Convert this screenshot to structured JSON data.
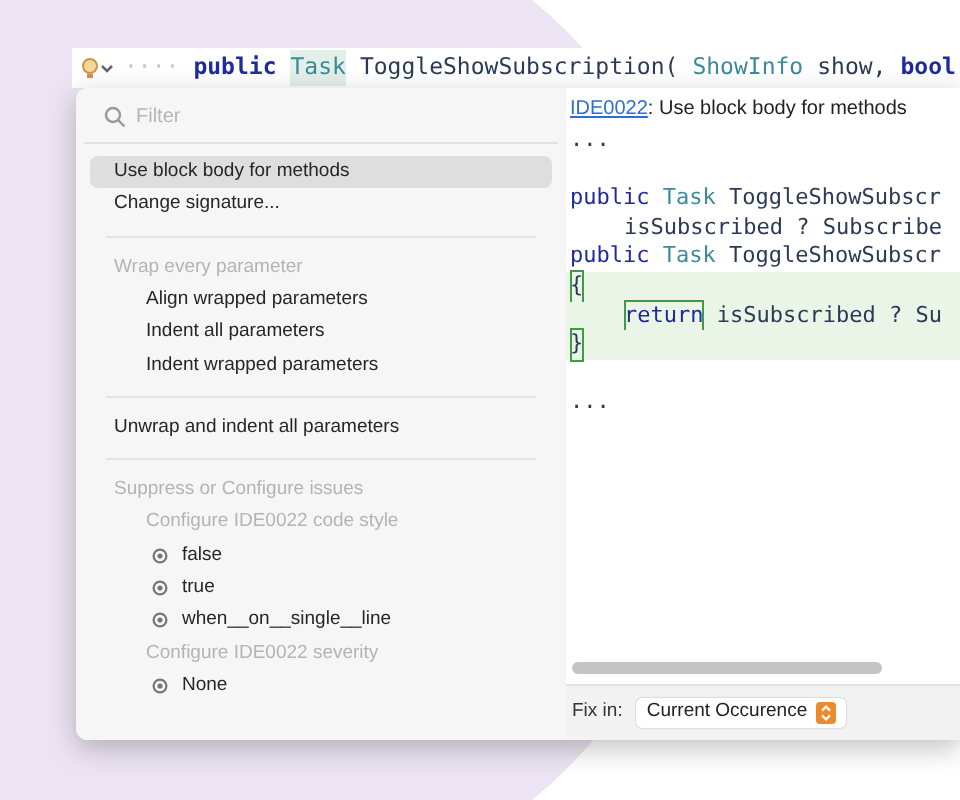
{
  "editor_line": {
    "tokens": [
      {
        "text": "····",
        "kind": "whitespace"
      },
      {
        "text": "public",
        "kind": "keyword"
      },
      {
        "text": "Task",
        "kind": "type_highlighted"
      },
      {
        "text": "ToggleShowSubscription(",
        "kind": "plain"
      },
      {
        "text": "ShowInfo",
        "kind": "type"
      },
      {
        "text": "show,",
        "kind": "plain"
      },
      {
        "text": "bool",
        "kind": "keyword"
      }
    ]
  },
  "menu": {
    "filter": {
      "placeholder": "Filter"
    },
    "items": [
      {
        "kind": "item",
        "label": "Use block body for methods",
        "selected": true
      },
      {
        "kind": "item",
        "label": "Change signature...",
        "selected": false
      },
      {
        "kind": "separator"
      },
      {
        "kind": "header",
        "label": "Wrap every parameter"
      },
      {
        "kind": "subitem",
        "label": "Align wrapped parameters",
        "selected": false
      },
      {
        "kind": "subitem",
        "label": "Indent all parameters",
        "selected": false
      },
      {
        "kind": "subitem",
        "label": "Indent wrapped parameters",
        "selected": false
      },
      {
        "kind": "separator"
      },
      {
        "kind": "item",
        "label": "Unwrap and indent all parameters",
        "selected": false
      },
      {
        "kind": "separator"
      },
      {
        "kind": "header",
        "label": "Suppress or Configure issues"
      },
      {
        "kind": "subheader",
        "label": "Configure IDE0022 code style"
      },
      {
        "kind": "option",
        "label": "false",
        "selected": false
      },
      {
        "kind": "option",
        "label": "true",
        "selected": false
      },
      {
        "kind": "option",
        "label": "when__on__single__line",
        "selected": false
      },
      {
        "kind": "subheader",
        "label": "Configure IDE0022 severity"
      },
      {
        "kind": "option",
        "label": "None",
        "selected": false
      }
    ]
  },
  "preview": {
    "rule_link": "IDE0022",
    "description": ": Use block body for methods",
    "lines": [
      {
        "kind": "code",
        "added": false,
        "indent": false,
        "tokens": [
          {
            "text": "...",
            "kind": "plain",
            "boxed": false
          }
        ]
      },
      {
        "kind": "blank"
      },
      {
        "kind": "code",
        "added": false,
        "indent": false,
        "tokens": [
          {
            "text": "public ",
            "kind": "keyword",
            "boxed": false
          },
          {
            "text": "Task ",
            "kind": "type",
            "boxed": false
          },
          {
            "text": "ToggleShowSubscr",
            "kind": "plain",
            "boxed": false
          }
        ]
      },
      {
        "kind": "code",
        "added": false,
        "indent": true,
        "tokens": [
          {
            "text": "isSubscribed ? Subscribe",
            "kind": "plain",
            "boxed": false
          }
        ]
      },
      {
        "kind": "code",
        "added": false,
        "indent": false,
        "tokens": [
          {
            "text": "public ",
            "kind": "keyword",
            "boxed": false
          },
          {
            "text": "Task ",
            "kind": "type",
            "boxed": false
          },
          {
            "text": "ToggleShowSubscr",
            "kind": "plain",
            "boxed": false
          }
        ]
      },
      {
        "kind": "code",
        "added": true,
        "indent": false,
        "tokens": [
          {
            "text": "{",
            "kind": "plain",
            "boxed": true
          }
        ]
      },
      {
        "kind": "code",
        "added": true,
        "indent": true,
        "tokens": [
          {
            "text": "return",
            "kind": "keyword",
            "boxed": true
          },
          {
            "text": " isSubscribed ? Su",
            "kind": "plain",
            "boxed": false
          }
        ]
      },
      {
        "kind": "code",
        "added": true,
        "indent": false,
        "tokens": [
          {
            "text": "}",
            "kind": "plain",
            "boxed": true
          }
        ]
      },
      {
        "kind": "blank"
      },
      {
        "kind": "code",
        "added": false,
        "indent": false,
        "tokens": [
          {
            "text": "...",
            "kind": "plain",
            "boxed": false
          }
        ]
      }
    ]
  },
  "fix_in": {
    "label": "Fix in:",
    "value": "Current Occurence"
  }
}
